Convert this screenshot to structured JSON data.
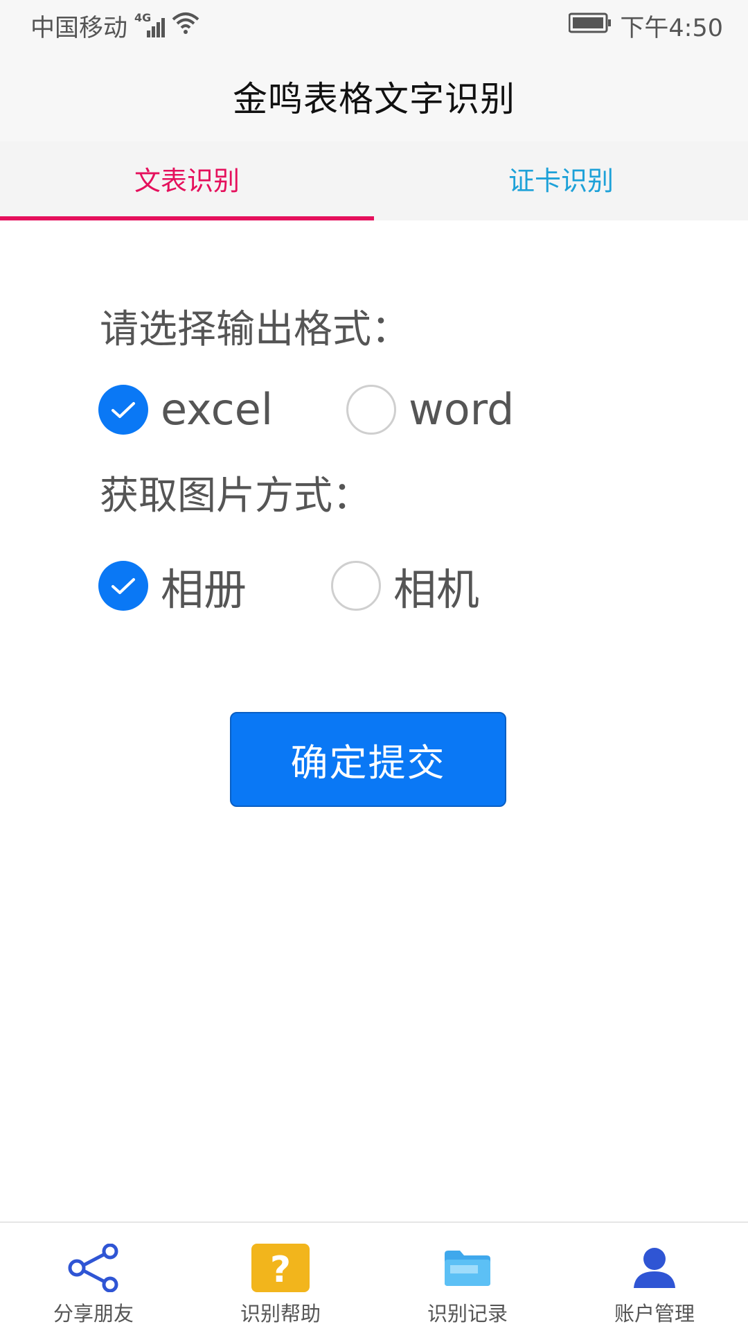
{
  "status_bar": {
    "carrier": "中国移动",
    "network": "4G",
    "time": "下午4:50"
  },
  "app": {
    "title": "金鸣表格文字识别"
  },
  "tabs": [
    {
      "label": "文表识别",
      "active": true
    },
    {
      "label": "证卡识别",
      "active": false
    }
  ],
  "output_format": {
    "label": "请选择输出格式：",
    "options": [
      {
        "label": "excel",
        "checked": true
      },
      {
        "label": "word",
        "checked": false
      }
    ]
  },
  "image_source": {
    "label": "获取图片方式：",
    "options": [
      {
        "label": "相册",
        "checked": true
      },
      {
        "label": "相机",
        "checked": false
      }
    ]
  },
  "submit": {
    "label": "确定提交"
  },
  "bottom_nav": [
    {
      "label": "分享朋友",
      "icon": "share-icon"
    },
    {
      "label": "识别帮助",
      "icon": "help-icon"
    },
    {
      "label": "识别记录",
      "icon": "folder-icon"
    },
    {
      "label": "账户管理",
      "icon": "user-icon"
    }
  ],
  "colors": {
    "accent_blue": "#0a78f5",
    "tab_active": "#e5105c",
    "tab_inactive": "#1da1d8",
    "help_icon": "#f2b51c"
  }
}
